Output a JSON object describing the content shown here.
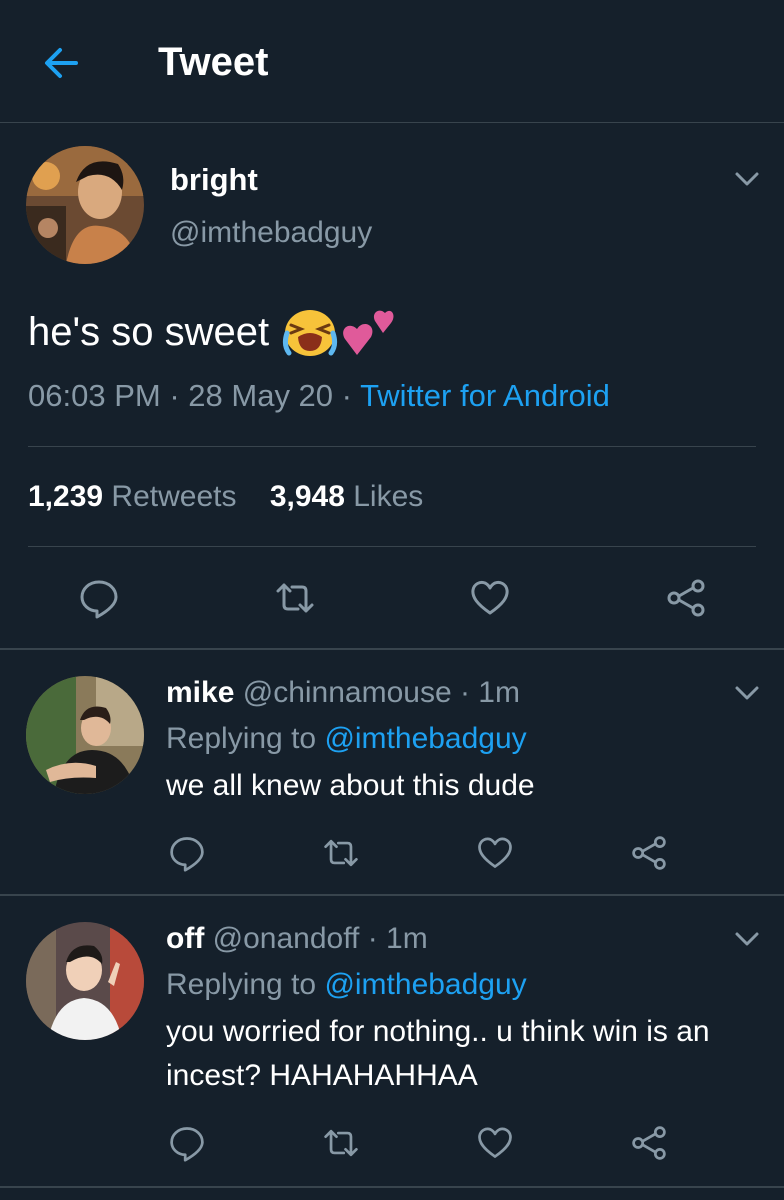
{
  "header": {
    "title": "Tweet",
    "back_icon": "arrow-left-icon",
    "accent": "#1da1f2"
  },
  "tweet": {
    "name": "bright",
    "handle": "@imthebadguy",
    "text": "he's so sweet",
    "emoji": [
      "loudly-crying-face",
      "two-hearts"
    ],
    "time": "06:03 PM",
    "sep": "·",
    "date": "28 May 20",
    "source": "Twitter for Android",
    "retweets_count": "1,239",
    "retweets_label": "Retweets",
    "likes_count": "3,948",
    "likes_label": "Likes"
  },
  "replies": [
    {
      "name": "mike",
      "handle": "@chinnamouse",
      "time": "· 1m",
      "replying_label": "Replying to",
      "replying_to": "@imthebadguy",
      "text": "we all knew about this dude"
    },
    {
      "name": "off",
      "handle": "@onandoff",
      "time": "· 1m",
      "replying_label": "Replying to",
      "replying_to": "@imthebadguy",
      "text": "you worried for nothing.. u think win is an incest? HAHAHAHHAA"
    }
  ],
  "colors": {
    "background": "#15202b",
    "divider": "#38444d",
    "muted": "#8899a6",
    "link": "#1da1f2"
  }
}
